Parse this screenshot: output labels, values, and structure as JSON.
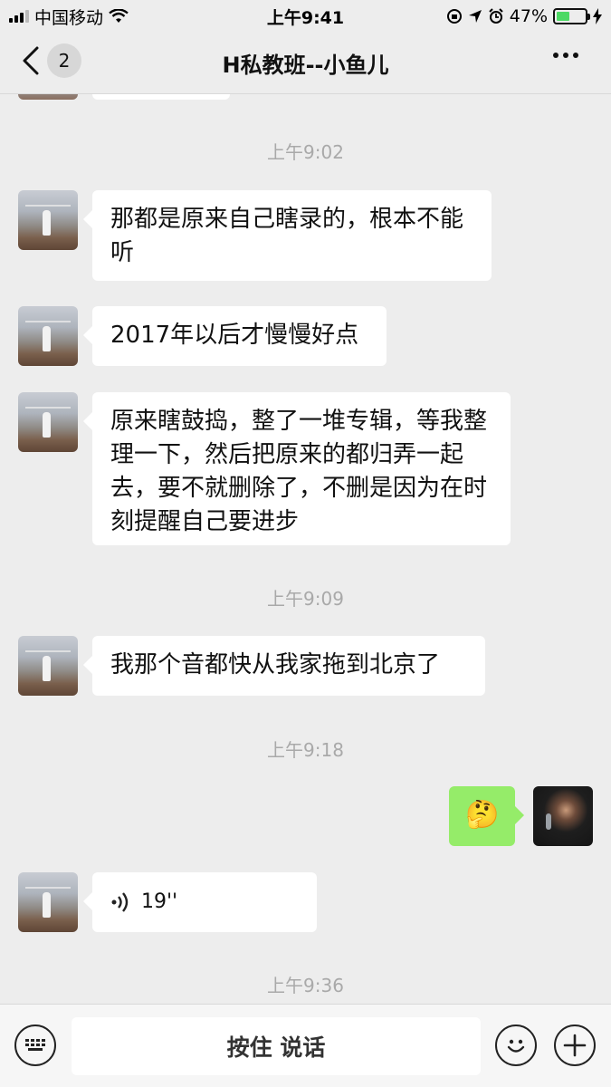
{
  "status_bar": {
    "carrier": "中国移动",
    "time": "上午9:41",
    "battery": "47%",
    "battery_level": 0.47
  },
  "header": {
    "back_count": "2",
    "title": "H私教班--小鱼儿"
  },
  "messages": [
    {
      "type": "timestamp",
      "text": "上午9:02"
    },
    {
      "type": "text",
      "side": "left",
      "text": " 那都是原来自己瞎录的，根本不能听"
    },
    {
      "type": "text",
      "side": "left",
      "text": "2017年以后才慢慢好点"
    },
    {
      "type": "text",
      "side": "left",
      "text": "原来瞎鼓捣，整了一堆专辑，等我整理一下，然后把原来的都归弄一起去，要不就删除了，不删是因为在时刻提醒自己要进步"
    },
    {
      "type": "timestamp",
      "text": "上午9:09"
    },
    {
      "type": "text",
      "side": "left",
      "text": "我那个音都快从我家拖到北京了"
    },
    {
      "type": "timestamp",
      "text": "上午9:18"
    },
    {
      "type": "emoji",
      "side": "right",
      "text": "🤔"
    },
    {
      "type": "voice",
      "side": "left",
      "duration": "19''"
    },
    {
      "type": "timestamp",
      "text": "上午9:36"
    }
  ],
  "input_bar": {
    "hold_to_talk": "按住 说话"
  },
  "icons": {
    "back": "chevron-left-icon",
    "more": "more-icon",
    "keyboard": "keyboard-icon",
    "emoji": "emoji-icon",
    "plus": "plus-icon",
    "voice": "voice-wave-icon"
  },
  "colors": {
    "background": "#ededed",
    "bubble_self": "#95ec69",
    "bubble_other": "#ffffff"
  }
}
